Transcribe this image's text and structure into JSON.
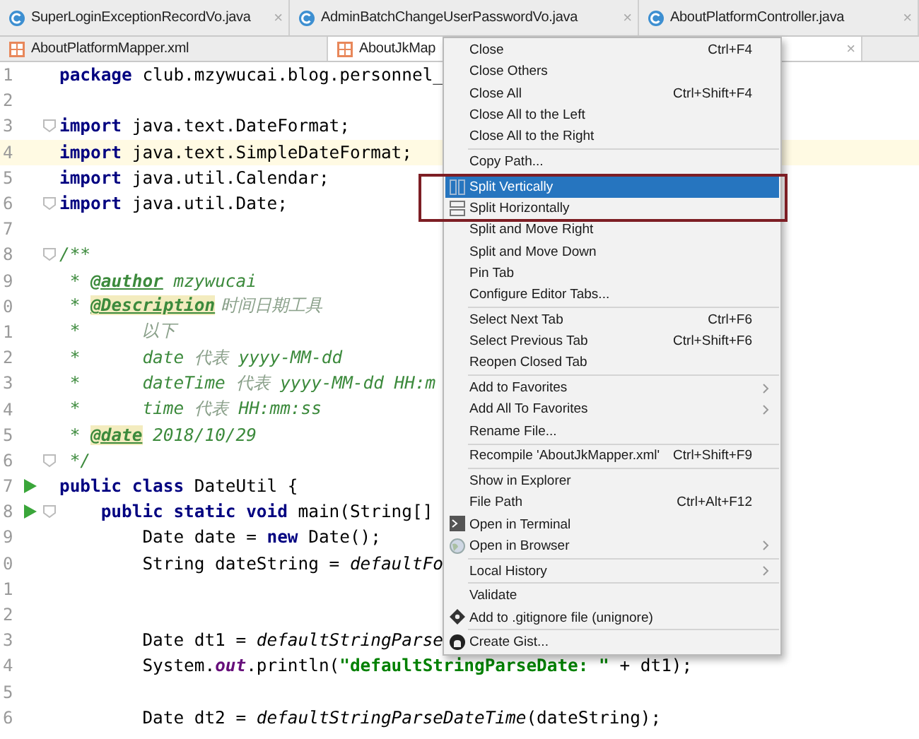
{
  "tab_rows": [
    [
      {
        "label": "SuperLoginExceptionRecordVo.java",
        "kind": "class",
        "selected": false,
        "close": "×"
      },
      {
        "label": "AdminBatchChangeUserPasswordVo.java",
        "kind": "class",
        "selected": false,
        "close": "×"
      },
      {
        "label": "AboutPlatformController.java",
        "kind": "class",
        "selected": false,
        "close": "×"
      }
    ],
    [
      {
        "label": "AboutPlatformMapper.xml",
        "kind": "xml",
        "selected": false
      },
      {
        "label": "AboutJkMap",
        "kind": "xml",
        "selected": true,
        "close": "×"
      }
    ]
  ],
  "editor": {
    "lines": [
      {
        "number": "1",
        "run": false,
        "fold": false,
        "current": false,
        "tokens": [
          {
            "kind": "keyword",
            "text": "package"
          },
          {
            "kind": "plain",
            "text": " club.mzywucai.blog.personnel_"
          }
        ]
      },
      {
        "number": "2",
        "run": false,
        "fold": false,
        "current": false
      },
      {
        "number": "3",
        "run": false,
        "fold": true,
        "current": false,
        "tokens": [
          {
            "kind": "keyword",
            "text": "import"
          },
          {
            "kind": "plain",
            "text": " java.text.DateFormat;"
          }
        ]
      },
      {
        "number": "4",
        "run": false,
        "fold": false,
        "current": true,
        "tokens": [
          {
            "kind": "keyword",
            "text": "import"
          },
          {
            "kind": "plain",
            "text": " java.text.SimpleDateFormat;"
          }
        ]
      },
      {
        "number": "5",
        "run": false,
        "fold": false,
        "current": false,
        "tokens": [
          {
            "kind": "keyword",
            "text": "import"
          },
          {
            "kind": "plain",
            "text": " java.util.Calendar;"
          }
        ]
      },
      {
        "number": "6",
        "run": false,
        "fold": true,
        "current": false,
        "tokens": [
          {
            "kind": "keyword",
            "text": "import"
          },
          {
            "kind": "plain",
            "text": " java.util.Date;"
          }
        ]
      },
      {
        "number": "7",
        "run": false,
        "fold": false,
        "current": false
      },
      {
        "number": "8",
        "run": false,
        "fold": true,
        "current": false,
        "tokens": [
          {
            "kind": "doc",
            "text": "/**"
          }
        ]
      },
      {
        "number": "9",
        "run": false,
        "fold": false,
        "current": false,
        "tokens": [
          {
            "kind": "doc",
            "text": " * "
          },
          {
            "kind": "doctag",
            "text": "@author"
          },
          {
            "kind": "doc",
            "text": " mzywucai"
          }
        ]
      },
      {
        "number": "0",
        "run": false,
        "fold": false,
        "current": false,
        "tokens": [
          {
            "kind": "doc",
            "text": " * "
          },
          {
            "kind": "doctag-marked",
            "text": "@Description"
          },
          {
            "kind": "cjk",
            "text": " 时间日期工具"
          }
        ]
      },
      {
        "number": "1",
        "run": false,
        "fold": false,
        "current": false,
        "tokens": [
          {
            "kind": "doc",
            "text": " *      "
          },
          {
            "kind": "cjk",
            "text": "以下"
          }
        ]
      },
      {
        "number": "2",
        "run": false,
        "fold": false,
        "current": false,
        "tokens": [
          {
            "kind": "doc",
            "text": " *      date "
          },
          {
            "kind": "cjk",
            "text": "代表"
          },
          {
            "kind": "doc",
            "text": " yyyy-MM-dd"
          }
        ]
      },
      {
        "number": "3",
        "run": false,
        "fold": false,
        "current": false,
        "tokens": [
          {
            "kind": "doc",
            "text": " *      dateTime "
          },
          {
            "kind": "cjk",
            "text": "代表"
          },
          {
            "kind": "doc",
            "text": " yyyy-MM-dd HH:m"
          }
        ]
      },
      {
        "number": "4",
        "run": false,
        "fold": false,
        "current": false,
        "tokens": [
          {
            "kind": "doc",
            "text": " *      time "
          },
          {
            "kind": "cjk",
            "text": "代表"
          },
          {
            "kind": "doc",
            "text": " HH:mm:ss"
          }
        ]
      },
      {
        "number": "5",
        "run": false,
        "fold": false,
        "current": false,
        "tokens": [
          {
            "kind": "doc",
            "text": " * "
          },
          {
            "kind": "doctag-marked",
            "text": "@date"
          },
          {
            "kind": "doc",
            "text": " 2018/10/29"
          }
        ]
      },
      {
        "number": "6",
        "run": false,
        "fold": true,
        "current": false,
        "tokens": [
          {
            "kind": "doc",
            "text": " */"
          }
        ]
      },
      {
        "number": "7",
        "run": true,
        "fold": false,
        "current": false,
        "tokens": [
          {
            "kind": "keyword",
            "text": "public class"
          },
          {
            "kind": "plain",
            "text": " DateUtil {"
          }
        ]
      },
      {
        "number": "8",
        "run": true,
        "fold": true,
        "current": false,
        "tokens": [
          {
            "kind": "keyword",
            "text": "    public static void"
          },
          {
            "kind": "plain",
            "text": " main(String[]"
          }
        ]
      },
      {
        "number": "9",
        "run": false,
        "fold": false,
        "current": false,
        "tokens": [
          {
            "kind": "plain",
            "text": "        Date date = "
          },
          {
            "kind": "keyword",
            "text": "new"
          },
          {
            "kind": "plain",
            "text": " Date();"
          }
        ]
      },
      {
        "number": "0",
        "run": false,
        "fold": false,
        "current": false,
        "tokens": [
          {
            "kind": "plain",
            "text": "        String dateString = "
          },
          {
            "kind": "static-call",
            "text": "defaultFo"
          }
        ]
      },
      {
        "number": "1",
        "run": false,
        "fold": false,
        "current": false
      },
      {
        "number": "2",
        "run": false,
        "fold": false,
        "current": false
      },
      {
        "number": "3",
        "run": false,
        "fold": false,
        "current": false,
        "tokens": [
          {
            "kind": "plain",
            "text": "        Date dt1 = "
          },
          {
            "kind": "static-call",
            "text": "defaultStringParse"
          }
        ]
      },
      {
        "number": "4",
        "run": false,
        "fold": false,
        "current": false,
        "tokens": [
          {
            "kind": "plain",
            "text": "        System."
          },
          {
            "kind": "field",
            "text": "out"
          },
          {
            "kind": "plain",
            "text": ".println("
          },
          {
            "kind": "string",
            "text": "\"defaultStringParseDate: \""
          },
          {
            "kind": "plain",
            "text": " + dt1);"
          }
        ]
      },
      {
        "number": "5",
        "run": false,
        "fold": false,
        "current": false
      },
      {
        "number": "6",
        "run": false,
        "fold": false,
        "current": false,
        "tokens": [
          {
            "kind": "plain",
            "text": "        Date dt2 = "
          },
          {
            "kind": "static-call",
            "text": "defaultStringParseDateTime"
          },
          {
            "kind": "plain",
            "text": "(dateString);"
          }
        ]
      }
    ]
  },
  "context_menu": {
    "items": [
      {
        "kind": "item",
        "label": "Close",
        "shortcut": "Ctrl+F4",
        "selected": false,
        "boxed": false
      },
      {
        "kind": "item",
        "label": "Close Others",
        "selected": false,
        "boxed": false
      },
      {
        "kind": "item",
        "label": "Close All",
        "shortcut": "Ctrl+Shift+F4",
        "selected": false,
        "boxed": false
      },
      {
        "kind": "item",
        "label": "Close All to the Left",
        "selected": false,
        "boxed": false
      },
      {
        "kind": "item",
        "label": "Close All to the Right",
        "selected": false,
        "boxed": false
      },
      {
        "kind": "separator"
      },
      {
        "kind": "item",
        "label": "Copy Path...",
        "selected": false,
        "boxed": false
      },
      {
        "kind": "separator"
      },
      {
        "kind": "vsplit",
        "label": "Split Vertically",
        "selected": true,
        "boxed": true
      },
      {
        "kind": "hsplit",
        "label": "Split Horizontally",
        "selected": false,
        "boxed": true
      },
      {
        "kind": "item",
        "label": "Split and Move Right",
        "selected": false,
        "boxed": false
      },
      {
        "kind": "item",
        "label": "Split and Move Down",
        "selected": false,
        "boxed": false
      },
      {
        "kind": "item",
        "label": "Pin Tab",
        "selected": false,
        "boxed": false
      },
      {
        "kind": "item",
        "label": "Configure Editor Tabs...",
        "selected": false,
        "boxed": false
      },
      {
        "kind": "separator"
      },
      {
        "kind": "item",
        "label": "Select Next Tab",
        "shortcut": "Ctrl+F6",
        "selected": false,
        "boxed": false
      },
      {
        "kind": "item",
        "label": "Select Previous Tab",
        "shortcut": "Ctrl+Shift+F6",
        "selected": false,
        "boxed": false
      },
      {
        "kind": "item",
        "label": "Reopen Closed Tab",
        "selected": false,
        "boxed": false
      },
      {
        "kind": "separator"
      },
      {
        "kind": "item",
        "label": "Add to Favorites",
        "submenu": true,
        "selected": false,
        "boxed": false
      },
      {
        "kind": "item",
        "label": "Add All To Favorites",
        "submenu": true,
        "selected": false,
        "boxed": false
      },
      {
        "kind": "item",
        "label": "Rename File...",
        "selected": false,
        "boxed": false
      },
      {
        "kind": "separator"
      },
      {
        "kind": "item",
        "label": "Recompile 'AboutJkMapper.xml'",
        "shortcut": "Ctrl+Shift+F9",
        "selected": false,
        "boxed": false
      },
      {
        "kind": "separator"
      },
      {
        "kind": "item",
        "label": "Show in Explorer",
        "selected": false,
        "boxed": false
      },
      {
        "kind": "item",
        "label": "File Path",
        "shortcut": "Ctrl+Alt+F12",
        "selected": false,
        "boxed": false
      },
      {
        "kind": "terminal",
        "label": "Open in Terminal",
        "selected": false,
        "boxed": false
      },
      {
        "kind": "browser",
        "label": "Open in Browser",
        "submenu": true,
        "selected": false,
        "boxed": false
      },
      {
        "kind": "separator"
      },
      {
        "kind": "item",
        "label": "Local History",
        "submenu": true,
        "selected": false,
        "boxed": false
      },
      {
        "kind": "separator"
      },
      {
        "kind": "item",
        "label": "Validate",
        "selected": false,
        "boxed": false
      },
      {
        "kind": "gitignore",
        "label": "Add to .gitignore file (unignore)",
        "selected": false,
        "boxed": false
      },
      {
        "kind": "separator"
      },
      {
        "kind": "gist",
        "label": "Create Gist...",
        "selected": false,
        "boxed": false
      }
    ]
  }
}
